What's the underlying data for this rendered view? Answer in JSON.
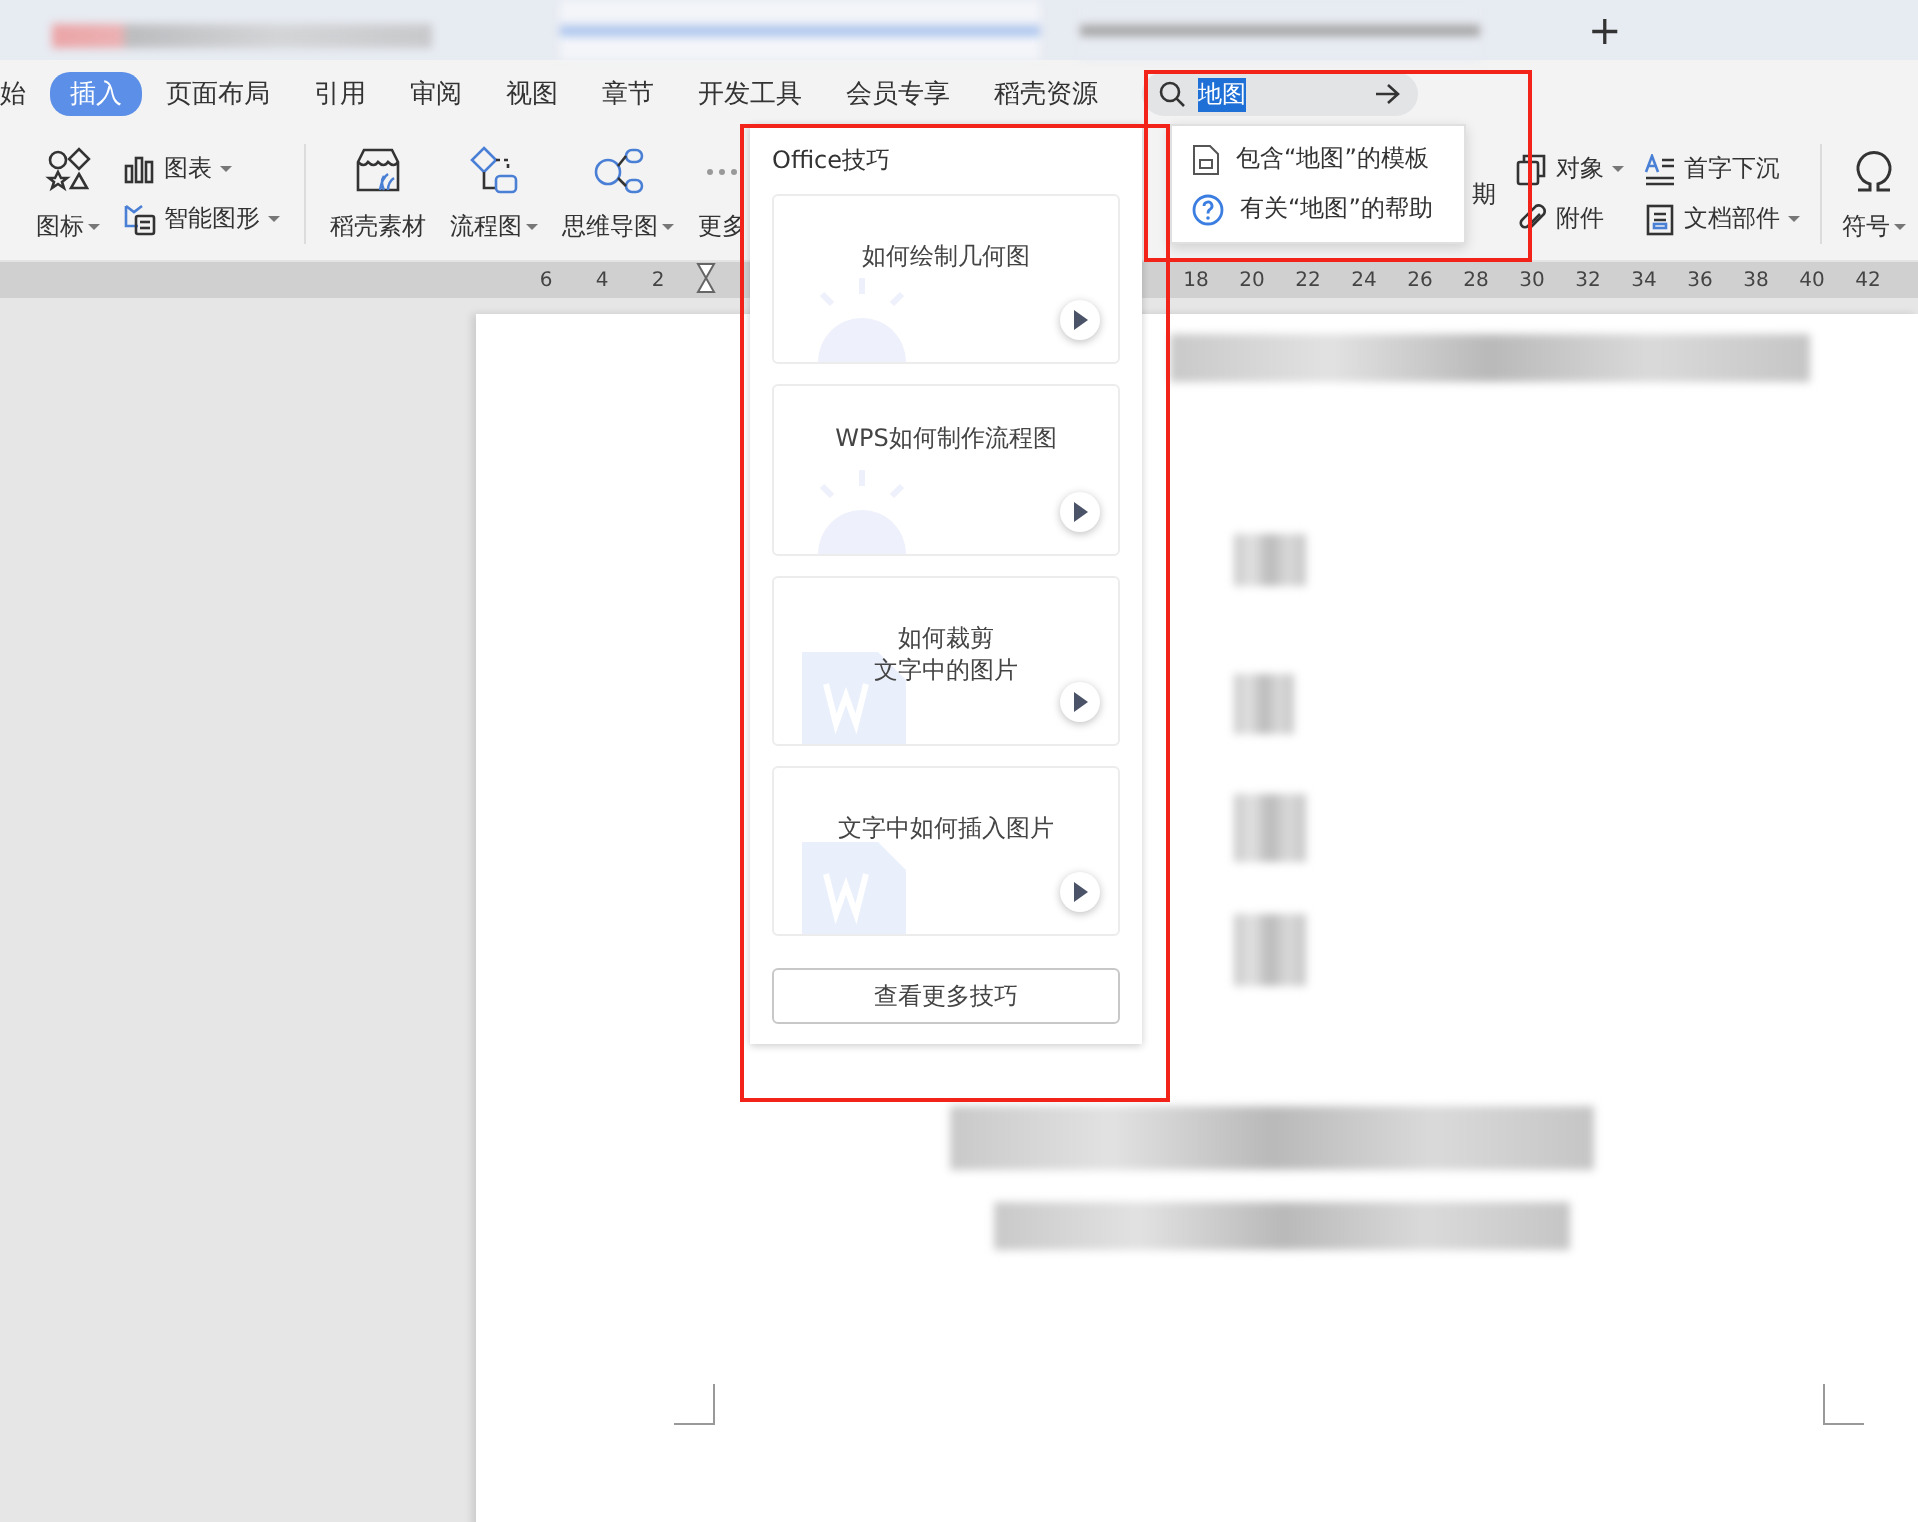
{
  "title_bar": {
    "new_tab_button": "+"
  },
  "menu_tabs": [
    {
      "label": "始",
      "selected": false
    },
    {
      "label": "插入",
      "selected": true
    },
    {
      "label": "页面布局",
      "selected": false
    },
    {
      "label": "引用",
      "selected": false
    },
    {
      "label": "审阅",
      "selected": false
    },
    {
      "label": "视图",
      "selected": false
    },
    {
      "label": "章节",
      "selected": false
    },
    {
      "label": "开发工具",
      "selected": false
    },
    {
      "label": "会员专享",
      "selected": false
    },
    {
      "label": "稻壳资源",
      "selected": false
    }
  ],
  "search": {
    "value": "地图"
  },
  "search_suggestions": [
    {
      "kind": "template",
      "label": "包含“地图”的模板"
    },
    {
      "kind": "help",
      "label": "有关“地图”的帮助"
    }
  ],
  "toolbar_left": [
    {
      "kind": "large",
      "label": "图标",
      "dropdown": true
    },
    {
      "kind": "stack",
      "items": [
        {
          "label": "图表",
          "dropdown": true
        },
        {
          "label": "智能图形",
          "dropdown": true
        }
      ]
    },
    {
      "kind": "separator"
    },
    {
      "kind": "large",
      "label": "稻壳素材",
      "dropdown": false
    },
    {
      "kind": "large",
      "label": "流程图",
      "dropdown": true
    },
    {
      "kind": "large",
      "label": "思维导图",
      "dropdown": true
    },
    {
      "kind": "large",
      "label": "更多",
      "dropdown": false
    }
  ],
  "toolbar_right": [
    {
      "kind": "stack",
      "items": [
        {
          "label": "期",
          "dropdown": false
        }
      ]
    },
    {
      "kind": "stack",
      "items": [
        {
          "label": "对象",
          "dropdown": true
        },
        {
          "label": "附件",
          "dropdown": false
        }
      ]
    },
    {
      "kind": "stack",
      "items": [
        {
          "label": "首字下沉",
          "dropdown": false
        },
        {
          "label": "文档部件",
          "dropdown": true
        }
      ]
    },
    {
      "kind": "separator"
    },
    {
      "kind": "large",
      "label": "符号",
      "dropdown": true
    }
  ],
  "ruler": {
    "left_numbers": [
      "6",
      "4",
      "2"
    ],
    "right_numbers": [
      "18",
      "20",
      "22",
      "24",
      "26",
      "28",
      "30",
      "32",
      "34",
      "36",
      "38",
      "40",
      "42"
    ]
  },
  "tips_panel": {
    "title": "Office技巧",
    "cards": [
      {
        "kind": "bulb",
        "title_lines": [
          "如何绘制几何图"
        ]
      },
      {
        "kind": "bulb",
        "title_lines": [
          "WPS如何制作流程图"
        ]
      },
      {
        "kind": "doc",
        "title_lines": [
          "如何裁剪",
          "文字中的图片"
        ]
      },
      {
        "kind": "doc",
        "title_lines": [
          "文字中如何插入图片"
        ]
      }
    ],
    "more_button": "查看更多技巧"
  }
}
